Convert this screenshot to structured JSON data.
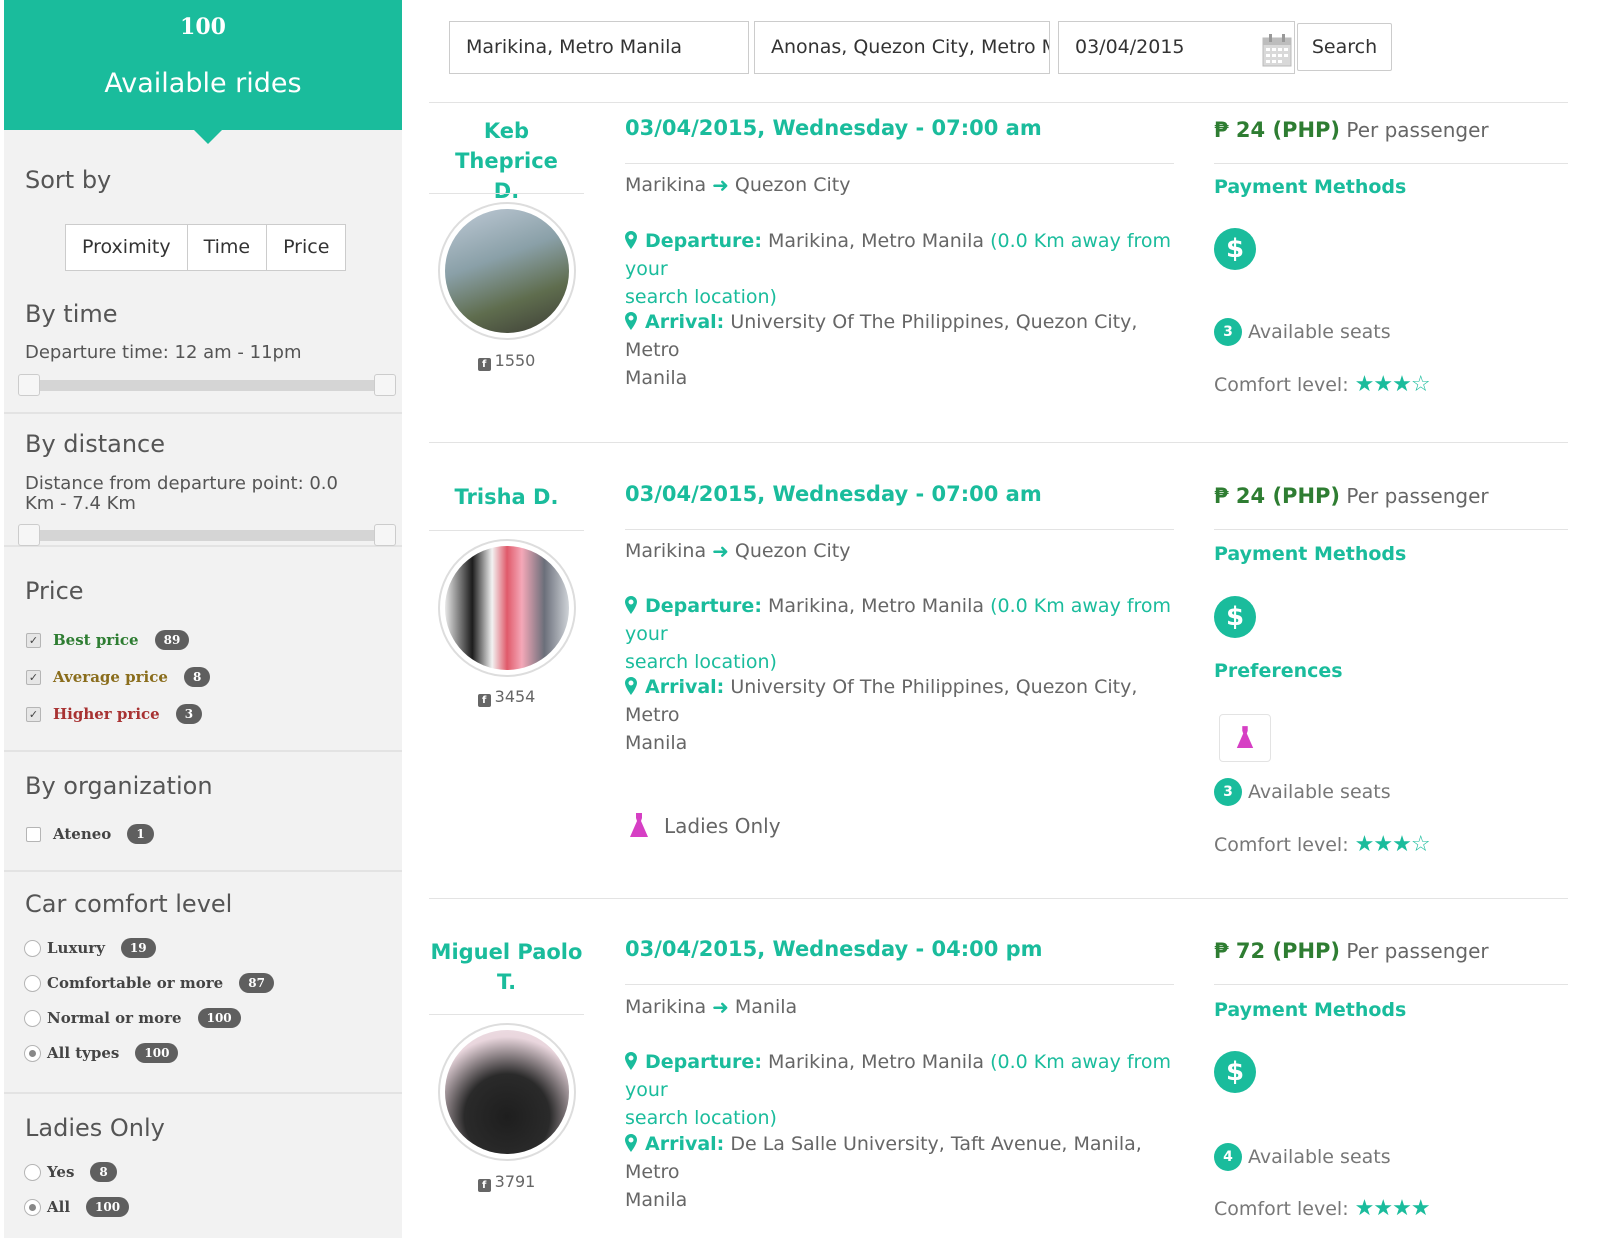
{
  "sidebar": {
    "count": "100",
    "title": "Available rides",
    "sort": {
      "title": "Sort by",
      "options": [
        "Proximity",
        "Time",
        "Price"
      ]
    },
    "by_time": {
      "title": "By time",
      "text": "Departure time: 12 am - 11pm"
    },
    "by_distance": {
      "title": "By distance",
      "text_line1": "Distance from departure point: 0.0",
      "text_line2": "Km - 7.4 Km"
    },
    "price": {
      "title": "Price",
      "items": [
        {
          "label": "Best price",
          "count": "89",
          "color": "#2e7d32"
        },
        {
          "label": "Average price",
          "count": "8",
          "color": "#8a6d1c"
        },
        {
          "label": "Higher price",
          "count": "3",
          "color": "#a83232"
        }
      ]
    },
    "organization": {
      "title": "By organization",
      "items": [
        {
          "label": "Ateneo",
          "count": "1"
        }
      ]
    },
    "comfort": {
      "title": "Car comfort level",
      "items": [
        {
          "label": "Luxury",
          "count": "19"
        },
        {
          "label": "Comfortable or more",
          "count": "87"
        },
        {
          "label": "Normal or more",
          "count": "100"
        },
        {
          "label": "All types",
          "count": "100"
        }
      ]
    },
    "ladies": {
      "title": "Ladies Only",
      "items": [
        {
          "label": "Yes",
          "count": "8"
        },
        {
          "label": "All",
          "count": "100"
        }
      ]
    }
  },
  "search": {
    "from": "Marikina, Metro Manila",
    "to": "Anonas, Quezon City, Metro Manila",
    "date": "03/04/2015",
    "button": "Search"
  },
  "rides": [
    {
      "driver_line1": "Keb Theprice",
      "driver_line2": "D.",
      "fb_count": "1550",
      "date": "03/04/2015, Wednesday - 07:00 am",
      "from": "Marikina",
      "to": "Quezon City",
      "departure_label": "Departure:",
      "departure": "Marikina, Metro Manila",
      "distance_line1": "(0.0 Km away from your",
      "distance_line2": "search location)",
      "arrival_label": "Arrival:",
      "arrival_line1": "University Of The Philippines, Quezon City, Metro",
      "arrival_line2": "Manila",
      "price": "₱ 24 (PHP)",
      "price_suffix": "Per passenger",
      "payment_title": "Payment Methods",
      "payment_icon": "$",
      "seats": "3",
      "seats_label": "Available seats",
      "comfort_label": "Comfort level:",
      "comfort_stars": "★★★☆"
    },
    {
      "driver_line1": "Trisha D.",
      "fb_count": "3454",
      "date": "03/04/2015, Wednesday - 07:00 am",
      "from": "Marikina",
      "to": "Quezon City",
      "departure_label": "Departure:",
      "departure": "Marikina, Metro Manila",
      "distance_line1": "(0.0 Km away from your",
      "distance_line2": "search location)",
      "arrival_label": "Arrival:",
      "arrival_line1": "University Of The Philippines, Quezon City, Metro",
      "arrival_line2": "Manila",
      "ladies_label": "Ladies Only",
      "price": "₱ 24 (PHP)",
      "price_suffix": "Per passenger",
      "payment_title": "Payment Methods",
      "payment_icon": "$",
      "preferences_title": "Preferences",
      "seats": "3",
      "seats_label": "Available seats",
      "comfort_label": "Comfort level:",
      "comfort_stars": "★★★☆"
    },
    {
      "driver_line1": "Miguel Paolo",
      "driver_line2": "T.",
      "fb_count": "3791",
      "date": "03/04/2015, Wednesday - 04:00 pm",
      "from": "Marikina",
      "to": "Manila",
      "departure_label": "Departure:",
      "departure": "Marikina, Metro Manila",
      "distance_line1": "(0.0 Km away from your",
      "distance_line2": "search location)",
      "arrival_label": "Arrival:",
      "arrival_line1": "De La Salle University, Taft Avenue, Manila, Metro",
      "arrival_line2": "Manila",
      "price": "₱ 72 (PHP)",
      "price_suffix": "Per passenger",
      "payment_title": "Payment Methods",
      "payment_icon": "$",
      "seats": "4",
      "seats_label": "Available seats",
      "comfort_label": "Comfort level:",
      "comfort_stars": "★★★★"
    }
  ],
  "colors": {
    "accent": "#1abc9c",
    "price_green": "#2e7d32",
    "ladies_pink": "#d63fc4"
  },
  "icons": [
    "calendar-icon",
    "facebook-icon",
    "map-pin-icon",
    "arrow-right-icon",
    "dollar-icon",
    "dress-icon",
    "star-icon",
    "caret-down-icon"
  ]
}
